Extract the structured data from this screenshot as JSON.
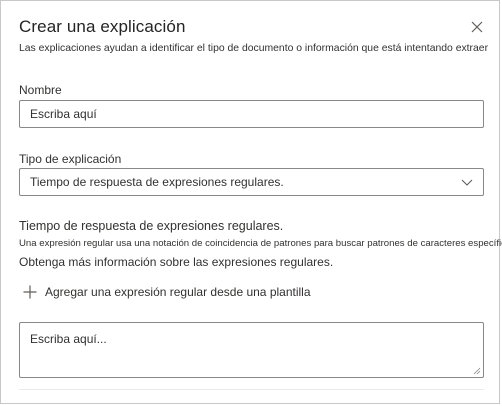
{
  "dialog": {
    "title": "Crear una explicación",
    "subtitle": "Las explicaciones ayudan a identificar el tipo de documento o información que está intentando extraer"
  },
  "icons": {
    "close": "close-icon",
    "dropdown": "chevron-down-icon",
    "add": "plus-icon",
    "resize": "resize-grip-icon"
  },
  "name_field": {
    "label": "Nombre",
    "value": "Escriba aquí"
  },
  "type_field": {
    "label": "Tipo de explicación",
    "selected": "Tiempo de respuesta de expresiones regulares."
  },
  "regex_section": {
    "title": "Tiempo de respuesta de expresiones regulares.",
    "description": "Una expresión regular usa una notación de coincidencia de patrones para buscar patrones de caracteres específicos.",
    "link": "Obtenga más información sobre las expresiones regulares.",
    "add_button": "Agregar una expresión regular desde una plantilla",
    "textarea_value": "Escriba aquí..."
  }
}
